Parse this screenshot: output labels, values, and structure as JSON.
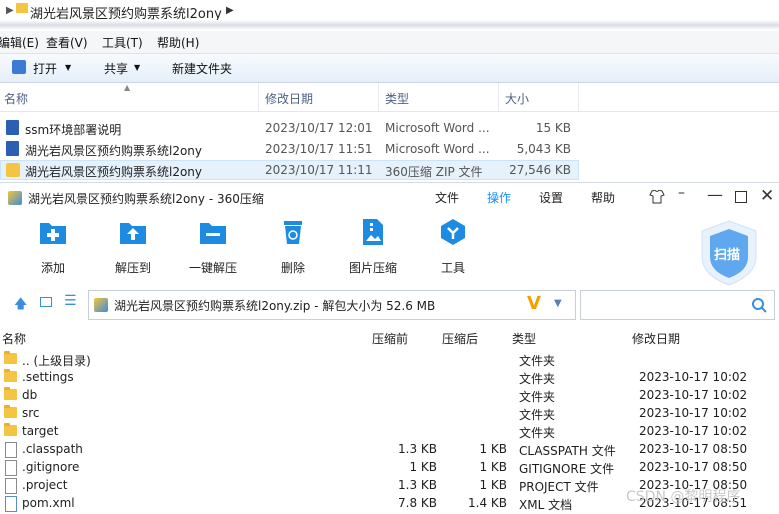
{
  "explorer": {
    "path": "湖光岩风景区预约购票系统l2ony",
    "menu": [
      "编辑(E)",
      "查看(V)",
      "工具(T)",
      "帮助(H)"
    ],
    "toolbar": {
      "open": "打开",
      "share": "共享",
      "new_folder": "新建文件夹"
    },
    "columns": {
      "name": "名称",
      "date": "修改日期",
      "type": "类型",
      "size": "大小"
    },
    "files": [
      {
        "name": "ssm环境部署说明",
        "date": "2023/10/17 12:01",
        "type": "Microsoft Word ...",
        "size": "15 KB"
      },
      {
        "name": "湖光岩风景区预约购票系统l2ony",
        "date": "2023/10/17 11:51",
        "type": "Microsoft Word ...",
        "size": "5,043 KB"
      },
      {
        "name": "湖光岩风景区预约购票系统l2ony",
        "date": "2023/10/17 11:11",
        "type": "360压缩 ZIP 文件",
        "size": "27,546 KB"
      }
    ]
  },
  "zip": {
    "title": "湖光岩风景区预约购票系统l2ony - 360压缩",
    "menu": {
      "file": "文件",
      "operate": "操作",
      "settings": "设置",
      "help": "帮助"
    },
    "tools": {
      "add": "添加",
      "extract_to": "解压到",
      "one_click": "一键解压",
      "delete": "删除",
      "image_compress": "图片压缩",
      "tools": "工具",
      "scan": "扫描"
    },
    "address": "湖光岩风景区预约购票系统l2ony.zip - 解包大小为 52.6 MB",
    "columns": {
      "name": "名称",
      "compressed": "压缩前",
      "after": "压缩后",
      "type": "类型",
      "date": "修改日期"
    },
    "rows": [
      {
        "name": ".. (上级目录)",
        "before": "",
        "after": "",
        "type": "文件夹",
        "date": "",
        "kind": "folder"
      },
      {
        "name": ".settings",
        "before": "",
        "after": "",
        "type": "文件夹",
        "date": "2023-10-17 10:02",
        "kind": "folder"
      },
      {
        "name": "db",
        "before": "",
        "after": "",
        "type": "文件夹",
        "date": "2023-10-17 10:02",
        "kind": "folder"
      },
      {
        "name": "src",
        "before": "",
        "after": "",
        "type": "文件夹",
        "date": "2023-10-17 10:02",
        "kind": "folder"
      },
      {
        "name": "target",
        "before": "",
        "after": "",
        "type": "文件夹",
        "date": "2023-10-17 10:02",
        "kind": "folder"
      },
      {
        "name": ".classpath",
        "before": "1.3 KB",
        "after": "1 KB",
        "type": "CLASSPATH 文件",
        "date": "2023-10-17 08:50",
        "kind": "file"
      },
      {
        "name": ".gitignore",
        "before": "1 KB",
        "after": "1 KB",
        "type": "GITIGNORE 文件",
        "date": "2023-10-17 08:50",
        "kind": "file"
      },
      {
        "name": ".project",
        "before": "1.3 KB",
        "after": "1 KB",
        "type": "PROJECT 文件",
        "date": "2023-10-17 08:50",
        "kind": "file"
      },
      {
        "name": "pom.xml",
        "before": "7.8 KB",
        "after": "1.4 KB",
        "type": "XML 文档",
        "date": "2023-10-17 08:51",
        "kind": "xml"
      }
    ]
  },
  "watermark": "CSDN @黎明程序",
  "colors": {
    "accent": "#1a8cff",
    "icon_blue": "#1e8be3",
    "selected_row": "#cce8ff"
  }
}
